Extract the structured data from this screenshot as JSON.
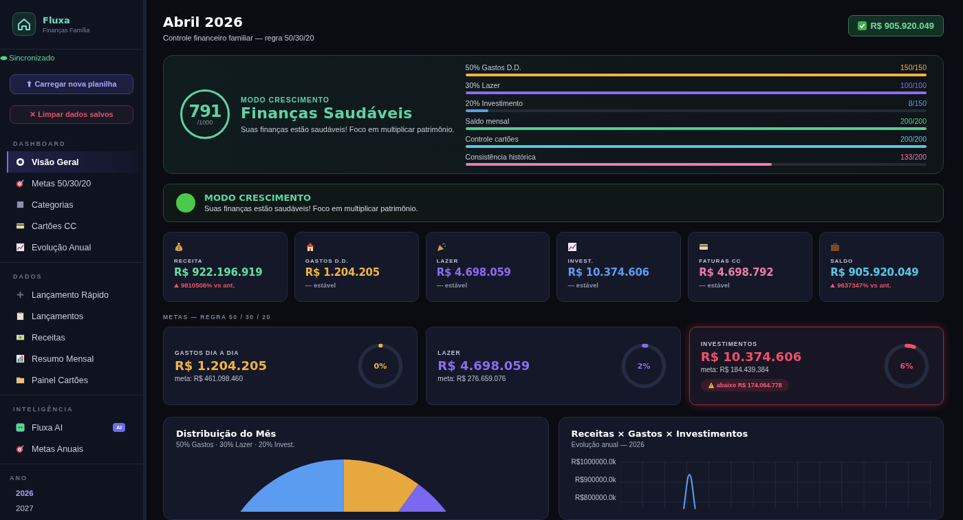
{
  "brand": {
    "name": "Fluxa",
    "subtitle": "Finanças Família"
  },
  "sync_status": "Sincronizado",
  "sidebar_buttons": [
    {
      "label": "⬆ Carregar nova planilha",
      "kind": "primary"
    },
    {
      "label": "✕ Limpar dados salvos",
      "kind": "danger"
    }
  ],
  "sidebar_sections": [
    {
      "title": "DASHBOARD",
      "items": [
        {
          "label": "Visão Geral",
          "selected": true
        },
        {
          "label": "Metas 50/30/20",
          "selected": false
        },
        {
          "label": "Categorias",
          "selected": false
        },
        {
          "label": "Cartões CC",
          "selected": false
        },
        {
          "label": "Evolução Anual",
          "selected": false
        }
      ]
    },
    {
      "title": "DADOS",
      "items": [
        {
          "label": "Lançamento Rápido",
          "selected": false
        },
        {
          "label": "Lançamentos",
          "selected": false
        },
        {
          "label": "Receitas",
          "selected": false
        },
        {
          "label": "Resumo Mensal",
          "selected": false
        },
        {
          "label": "Painel Cartões",
          "selected": false
        }
      ]
    },
    {
      "title": "INTELIGÊNCIA",
      "items": [
        {
          "label": "Fluxa AI",
          "selected": false,
          "badge": "AI"
        },
        {
          "label": "Metas Anuais",
          "selected": false
        }
      ]
    }
  ],
  "years": {
    "title": "ANO",
    "items": [
      {
        "label": "2026",
        "selected": true
      },
      {
        "label": "2027",
        "selected": false
      }
    ]
  },
  "header": {
    "title": "Abril 2026",
    "subtitle": "Controle financeiro familiar — regra 50/30/20",
    "balance_badge": "R$ 905.920.049"
  },
  "health": {
    "score": "791",
    "score_max": "/1000",
    "mode": "MODO CRESCIMENTO",
    "title": "Finanças Saudáveis",
    "message": "Suas finanças estão saudáveis! Foco em multiplicar patrimônio.",
    "bars": [
      {
        "label": "50% Gastos D.D.",
        "value": "150/150",
        "level": 1,
        "color": "#f0b43c"
      },
      {
        "label": "30% Lazer",
        "value": "100/100",
        "level": 1,
        "color": "#8b6cf0"
      },
      {
        "label": "20% Investimento",
        "value": "8/150",
        "level": 0.05,
        "color": "#5b9cf0"
      },
      {
        "label": "Saldo mensal",
        "value": "200/200",
        "level": 1,
        "color": "#4fd18f"
      },
      {
        "label": "Controle cartões",
        "value": "200/200",
        "level": 1,
        "color": "#56c8e8"
      },
      {
        "label": "Consistência histórica",
        "value": "133/200",
        "level": 0.665,
        "color": "#f07aaa"
      }
    ]
  },
  "mode_banner": {
    "title": "MODO CRESCIMENTO",
    "message": "Suas finanças estão saudáveis! Foco em multiplicar patrimônio.",
    "color": "#4cc94a"
  },
  "kpis": [
    {
      "label": "RECEITA",
      "value": "R$ 922.196.919",
      "trend": "9810506% vs ant.",
      "rising": true,
      "color": "#5ee0a0"
    },
    {
      "label": "GASTOS D.D.",
      "value": "R$ 1.204.205",
      "trend": "— estável",
      "rising": false,
      "color": "#f0b43c"
    },
    {
      "label": "LAZER",
      "value": "R$ 4.698.059",
      "trend": "— estável",
      "rising": false,
      "color": "#8b6cf0"
    },
    {
      "label": "INVEST.",
      "value": "R$ 10.374.606",
      "trend": "— estável",
      "rising": false,
      "color": "#5b9cf0"
    },
    {
      "label": "FATURAS CC",
      "value": "R$ 4.698.792",
      "trend": "— estável",
      "rising": false,
      "color": "#f07aaa"
    },
    {
      "label": "SALDO",
      "value": "R$ 905.920.049",
      "trend": "9637347% vs ant.",
      "rising": true,
      "color": "#56c8e8"
    }
  ],
  "goals_title": "METAS — REGRA 50 / 30 / 20",
  "goals": [
    {
      "label": "GASTOS DIA A DIA",
      "value": "R$ 1.204.205",
      "meta": "meta: R$ 461.098.460",
      "percent": "0%",
      "level": 0.004,
      "color": "#f0b43c",
      "alert": false
    },
    {
      "label": "LAZER",
      "value": "R$ 4.698.059",
      "meta": "meta: R$ 276.659.076",
      "percent": "2%",
      "level": 0.02,
      "color": "#8b6cf0",
      "alert": false
    },
    {
      "label": "INVESTIMENTOS",
      "value": "R$ 10.374.606",
      "meta": "meta: R$ 184.439.384",
      "percent": "6%",
      "level": 0.06,
      "color": "#f0506a",
      "alert": true,
      "warning": "abaixo R$ 174.064.778"
    }
  ],
  "distribution": {
    "title": "Distribuição do Mês",
    "subtitle": "50% Gastos · 30% Lazer · 20% Invest."
  },
  "evolution": {
    "title": "Receitas × Gastos × Investimentos",
    "subtitle": "Evolução anual — 2026",
    "y_labels": [
      "R$1000000.0k",
      "R$900000.0k",
      "R$800000.0k"
    ]
  }
}
